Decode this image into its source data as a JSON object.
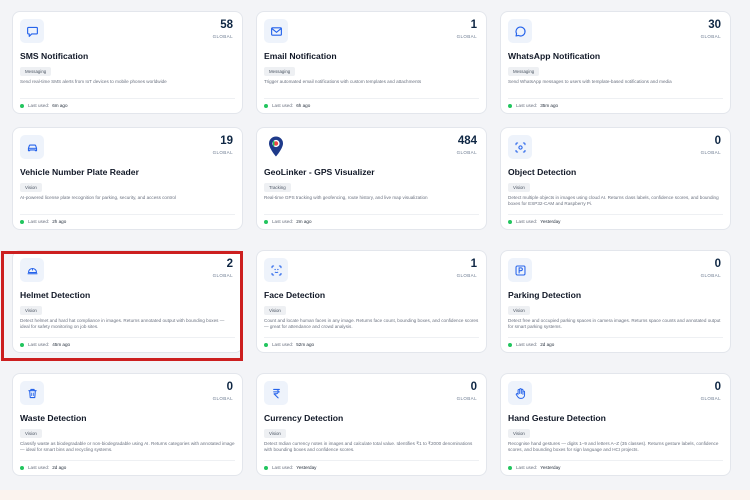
{
  "cards": [
    {
      "icon": "chat-bubble-icon",
      "count": "58",
      "scope": "GLOBAL",
      "title": "SMS Notification",
      "tag": "Messaging",
      "desc": "Send real-time SMS alerts from IoT devices to mobile phones worldwide",
      "last_used_label": "Last used:",
      "last_used": "6m ago"
    },
    {
      "icon": "envelope-icon",
      "count": "1",
      "scope": "GLOBAL",
      "title": "Email Notification",
      "tag": "Messaging",
      "desc": "Trigger automated email notifications with custom templates and attachments",
      "last_used_label": "Last used:",
      "last_used": "6h ago"
    },
    {
      "icon": "whatsapp-icon",
      "count": "30",
      "scope": "GLOBAL",
      "title": "WhatsApp Notification",
      "tag": "Messaging",
      "desc": "Send WhatsApp messages to users with template-based notifications and media",
      "last_used_label": "Last used:",
      "last_used": "35m ago"
    },
    {
      "icon": "car-icon",
      "count": "19",
      "scope": "GLOBAL",
      "title": "Vehicle Number Plate Reader",
      "tag": "Vision",
      "desc": "AI-powered license plate recognition for parking, security, and access control",
      "last_used_label": "Last used:",
      "last_used": "2h ago"
    },
    {
      "icon": "map-pin-icon",
      "count": "484",
      "scope": "GLOBAL",
      "title": "GeoLinker - GPS Visualizer",
      "tag": "Tracking",
      "desc": "Real-time GPS tracking with geofencing, route history, and live map visualization",
      "last_used_label": "Last used:",
      "last_used": "2m ago"
    },
    {
      "icon": "object-scan-icon",
      "count": "0",
      "scope": "GLOBAL",
      "title": "Object Detection",
      "tag": "Vision",
      "desc": "Detect multiple objects in images using cloud AI. Returns class labels, confidence scores, and bounding boxes for ESP32-CAM and Raspberry Pi.",
      "last_used_label": "Last used:",
      "last_used": "Yesterday"
    },
    {
      "icon": "helmet-icon",
      "count": "2",
      "scope": "GLOBAL",
      "title": "Helmet Detection",
      "tag": "Vision",
      "desc": "Detect helmet and hard hat compliance in images. Returns annotated output with bounding boxes — ideal for safety monitoring on job sites.",
      "last_used_label": "Last used:",
      "last_used": "45m ago"
    },
    {
      "icon": "face-scan-icon",
      "count": "1",
      "scope": "GLOBAL",
      "title": "Face Detection",
      "tag": "Vision",
      "desc": "Count and locate human faces in any image. Returns face count, bounding boxes, and confidence scores — great for attendance and crowd analysis.",
      "last_used_label": "Last used:",
      "last_used": "52m ago"
    },
    {
      "icon": "parking-icon",
      "count": "0",
      "scope": "GLOBAL",
      "title": "Parking Detection",
      "tag": "Vision",
      "desc": "Detect free and occupied parking spaces in camera images. Returns space counts and annotated output for smart parking systems.",
      "last_used_label": "Last used:",
      "last_used": "2d ago"
    },
    {
      "icon": "trash-icon",
      "count": "0",
      "scope": "GLOBAL",
      "title": "Waste Detection",
      "tag": "Vision",
      "desc": "Classify waste as biodegradable or non-biodegradable using AI. Returns categories with annotated image — ideal for smart bins and recycling systems.",
      "last_used_label": "Last used:",
      "last_used": "2d ago"
    },
    {
      "icon": "rupee-icon",
      "count": "0",
      "scope": "GLOBAL",
      "title": "Currency Detection",
      "tag": "Vision",
      "desc": "Detect Indian currency notes in images and calculate total value. Identifies ₹1 to ₹2000 denominations with bounding boxes and confidence scores.",
      "last_used_label": "Last used:",
      "last_used": "Yesterday"
    },
    {
      "icon": "hand-icon",
      "count": "0",
      "scope": "GLOBAL",
      "title": "Hand Gesture Detection",
      "tag": "Vision",
      "desc": "Recognise hand gestures — digits 1–9 and letters A–Z (35 classes). Returns gesture labels, confidence scores, and bounding boxes for sign language and HCI projects.",
      "last_used_label": "Last used:",
      "last_used": "Yesterday"
    }
  ],
  "colors": {
    "accent": "#2563eb",
    "highlight": "#cc1f1f",
    "status": "#22c55e",
    "count": "#0f2744"
  }
}
